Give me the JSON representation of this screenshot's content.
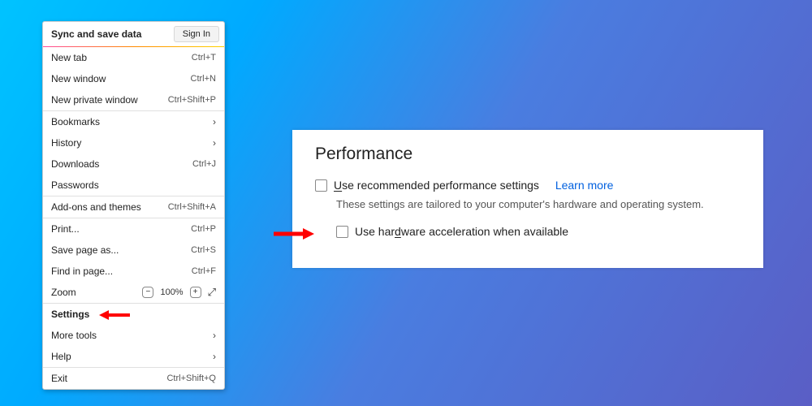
{
  "menu": {
    "sync_label": "Sync and save data",
    "signin": "Sign In",
    "new_tab": "New tab",
    "new_tab_sc": "Ctrl+T",
    "new_window": "New window",
    "new_window_sc": "Ctrl+N",
    "new_private": "New private window",
    "new_private_sc": "Ctrl+Shift+P",
    "bookmarks": "Bookmarks",
    "history": "History",
    "downloads": "Downloads",
    "downloads_sc": "Ctrl+J",
    "passwords": "Passwords",
    "addons": "Add-ons and themes",
    "addons_sc": "Ctrl+Shift+A",
    "print": "Print...",
    "print_sc": "Ctrl+P",
    "save_page": "Save page as...",
    "save_page_sc": "Ctrl+S",
    "find": "Find in page...",
    "find_sc": "Ctrl+F",
    "zoom": "Zoom",
    "zoom_level": "100%",
    "settings": "Settings",
    "more_tools": "More tools",
    "help": "Help",
    "exit": "Exit",
    "exit_sc": "Ctrl+Shift+Q"
  },
  "panel": {
    "title": "Performance",
    "use_recommended_pre": "U",
    "use_recommended_post": "se recommended performance settings",
    "learn_more": "Learn more",
    "tailored": "These settings are tailored to your computer's hardware and operating system.",
    "hw_pre": "Use har",
    "hw_mid": "d",
    "hw_post": "ware acceleration when available"
  }
}
